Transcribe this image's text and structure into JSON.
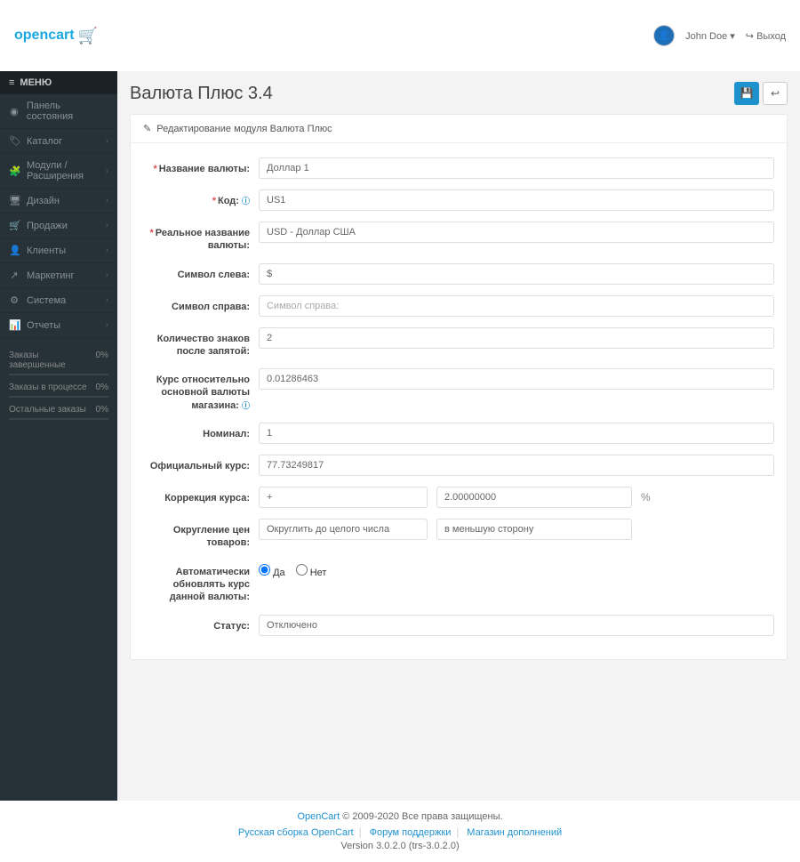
{
  "header": {
    "logo_text": "opencart",
    "user_name": "John Doe",
    "logout": "Выход"
  },
  "sidebar": {
    "menu_title": "МЕНЮ",
    "items": [
      {
        "icon": "◉",
        "label": "Панель состояния",
        "chev": false
      },
      {
        "icon": "🏷",
        "label": "Каталог",
        "chev": true
      },
      {
        "icon": "🧩",
        "label": "Модули / Расширения",
        "chev": true
      },
      {
        "icon": "🖥",
        "label": "Дизайн",
        "chev": true
      },
      {
        "icon": "🛒",
        "label": "Продажи",
        "chev": true
      },
      {
        "icon": "👤",
        "label": "Клиенты",
        "chev": true
      },
      {
        "icon": "↗",
        "label": "Маркетинг",
        "chev": true
      },
      {
        "icon": "⚙",
        "label": "Система",
        "chev": true
      },
      {
        "icon": "📊",
        "label": "Отчеты",
        "chev": true
      }
    ],
    "stats": [
      {
        "label": "Заказы завершенные",
        "value": "0%"
      },
      {
        "label": "Заказы в процессе",
        "value": "0%"
      },
      {
        "label": "Остальные заказы",
        "value": "0%"
      }
    ]
  },
  "page": {
    "title": "Валюта Плюс 3.4",
    "panel_title": "Редактирование модуля Валюта Плюс"
  },
  "form": {
    "name_label": "Название валюты:",
    "name_value": "Доллар 1",
    "code_label": "Код:",
    "code_value": "US1",
    "real_name_label": "Реальное название валюты:",
    "real_name_value": "USD - Доллар США",
    "symbol_left_label": "Символ слева:",
    "symbol_left_value": "$",
    "symbol_right_label": "Символ справа:",
    "symbol_right_placeholder": "Символ справа:",
    "decimals_label": "Количество знаков после запятой:",
    "decimals_value": "2",
    "rate_label": "Курс относительно основной валюты магазина:",
    "rate_value": "0.01286463",
    "nominal_label": "Номинал:",
    "nominal_value": "1",
    "official_label": "Официальный курс:",
    "official_value": "77.73249817",
    "correction_label": "Коррекция курса:",
    "correction_op": "+",
    "correction_value": "2.00000000",
    "correction_unit": "%",
    "rounding_label": "Округление цен товаров:",
    "rounding_mode": "Округлить до целого числа",
    "rounding_dir": "в меньшую сторону",
    "autoupdate_label": "Автоматически обновлять курс данной валюты:",
    "autoupdate_yes": "Да",
    "autoupdate_no": "Нет",
    "status_label": "Статус:",
    "status_value": "Отключено"
  },
  "footer": {
    "brand": "OpenCart",
    "copyright": " © 2009-2020 Все права защищены.",
    "link1": "Русская сборка OpenCart",
    "link2": "Форум поддержки",
    "link3": "Магазин дополнений",
    "version": "Version 3.0.2.0 (trs-3.0.2.0)"
  }
}
